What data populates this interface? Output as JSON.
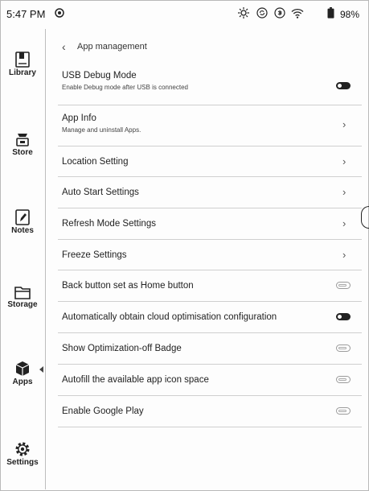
{
  "status_bar": {
    "time": "5:47 PM",
    "battery_percent": "98%",
    "icons": [
      "notification-icon",
      "brightness-icon",
      "refresh-icon",
      "bluetooth-icon",
      "wifi-icon",
      "battery-icon"
    ]
  },
  "sidebar": {
    "items": [
      {
        "label": "Library",
        "icon": "library-icon"
      },
      {
        "label": "Store",
        "icon": "store-icon"
      },
      {
        "label": "Notes",
        "icon": "notes-icon"
      },
      {
        "label": "Storage",
        "icon": "storage-icon"
      },
      {
        "label": "Apps",
        "icon": "apps-icon",
        "selected": true
      },
      {
        "label": "Settings",
        "icon": "settings-icon"
      }
    ]
  },
  "header": {
    "title": "App management"
  },
  "settings": [
    {
      "title": "USB Debug Mode",
      "subtitle": "Enable Debug mode after USB is connected",
      "control": "toggle",
      "state": "on"
    },
    {
      "title": "App Info",
      "subtitle": "Manage and uninstall Apps.",
      "control": "chevron"
    },
    {
      "title": "Location Setting",
      "control": "chevron"
    },
    {
      "title": "Auto Start Settings",
      "control": "chevron"
    },
    {
      "title": "Refresh Mode Settings",
      "control": "chevron"
    },
    {
      "title": "Freeze Settings",
      "control": "chevron"
    },
    {
      "title": "Back button set as Home button",
      "control": "toggle",
      "state": "off"
    },
    {
      "title": "Automatically obtain cloud optimisation configuration",
      "control": "toggle",
      "state": "on"
    },
    {
      "title": "Show Optimization-off Badge",
      "control": "toggle",
      "state": "off"
    },
    {
      "title": "Autofill the available app icon space",
      "control": "toggle",
      "state": "off"
    },
    {
      "title": "Enable Google Play",
      "control": "toggle",
      "state": "off"
    }
  ]
}
